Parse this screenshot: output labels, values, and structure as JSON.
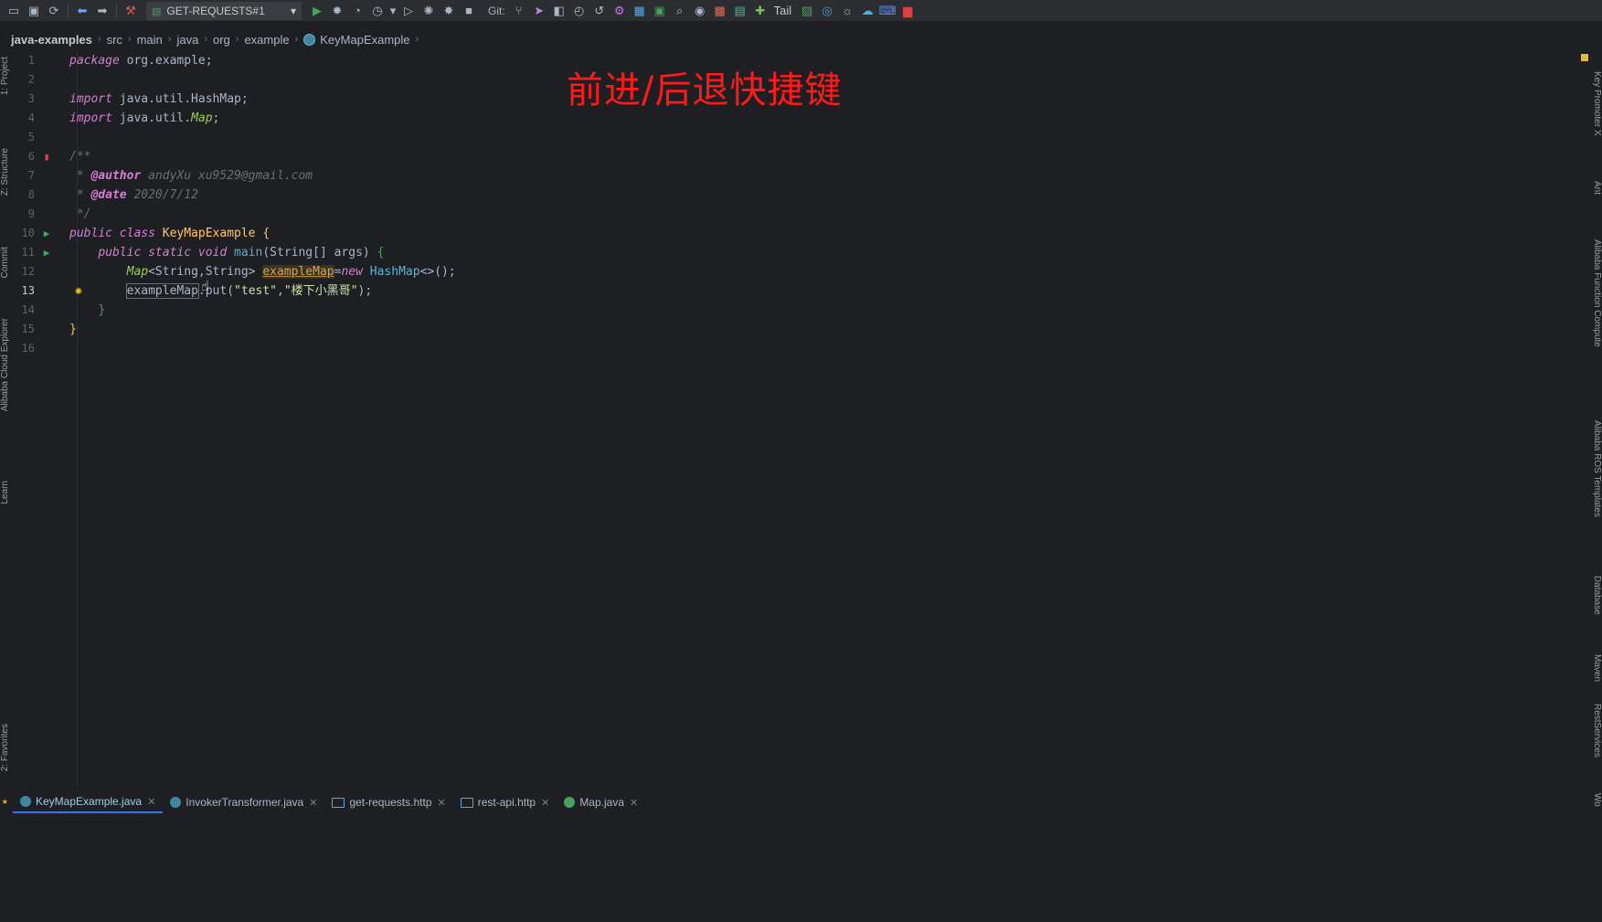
{
  "toolbar": {
    "run_config": "GET-REQUESTS#1",
    "git_label": "Git:",
    "tail_label": "Tail"
  },
  "breadcrumb": [
    "java-examples",
    "src",
    "main",
    "java",
    "org",
    "example",
    "KeyMapExample"
  ],
  "overlay_title": "前进/后退快捷键",
  "left_tools": [
    "1: Project",
    "Z: Structure",
    "Commit",
    "Alibaba Cloud Explorer",
    "Learn",
    "2: Favorites"
  ],
  "right_tools": [
    "Key Promoter X",
    "Ant",
    "Alibaba Function Compute",
    "Alibaba ROS Templates",
    "Database",
    "Maven",
    "RestServices",
    "Wo"
  ],
  "editor": {
    "current_line": 13,
    "lines": [
      {
        "n": "1"
      },
      {
        "n": "2"
      },
      {
        "n": "3"
      },
      {
        "n": "4"
      },
      {
        "n": "5"
      },
      {
        "n": "6"
      },
      {
        "n": "7"
      },
      {
        "n": "8"
      },
      {
        "n": "9"
      },
      {
        "n": "10"
      },
      {
        "n": "11"
      },
      {
        "n": "12"
      },
      {
        "n": "13"
      },
      {
        "n": "14"
      },
      {
        "n": "15"
      },
      {
        "n": "16"
      }
    ],
    "code": {
      "l1_kw": "package",
      "l1_rest": " org.example;",
      "l3_kw": "import",
      "l3_rest": " java.util.HashMap;",
      "l4_kw": "import",
      "l4_a": " java.util.",
      "l4_map": "Map",
      "l4_semi": ";",
      "l6": "/**",
      "l7_star": " * ",
      "l7_tag": "@author",
      "l7_text": " andyXu xu9529@gmail.com",
      "l8_star": " * ",
      "l8_tag": "@date",
      "l8_text": " 2020/7/12",
      "l9": " */",
      "l10_kw": "public class",
      "l10_name": " KeyMapExample ",
      "l10_brace": "{",
      "l11_kw": "public static void",
      "l11_method": " main",
      "l11_rest": "(String[] args) ",
      "l11_brace": "{",
      "l12_type": "Map",
      "l12_gen": "<String,String> ",
      "l12_var": "exampleMap",
      "l12_eq": "=",
      "l12_new": "new",
      "l12_cls": " HashMap",
      "l12_end": "<>();",
      "l13_var": "exampleMap",
      "l13_put": ".put(",
      "l13_s1": "\"test\"",
      "l13_comma": ",",
      "l13_s2": "\"楼下小黑哥\"",
      "l13_end": ");",
      "l14": "}",
      "l15": "}"
    }
  },
  "tabs": [
    {
      "label": "KeyMapExample.java",
      "active": true
    },
    {
      "label": "InvokerTransformer.java"
    },
    {
      "label": "get-requests.http"
    },
    {
      "label": "rest-api.http"
    },
    {
      "label": "Map.java"
    }
  ],
  "colors": {
    "background": "#1e1f22",
    "overlay_title": "#ff1a1a",
    "keyword": "#d47fd4",
    "run": "#4aa05c"
  }
}
